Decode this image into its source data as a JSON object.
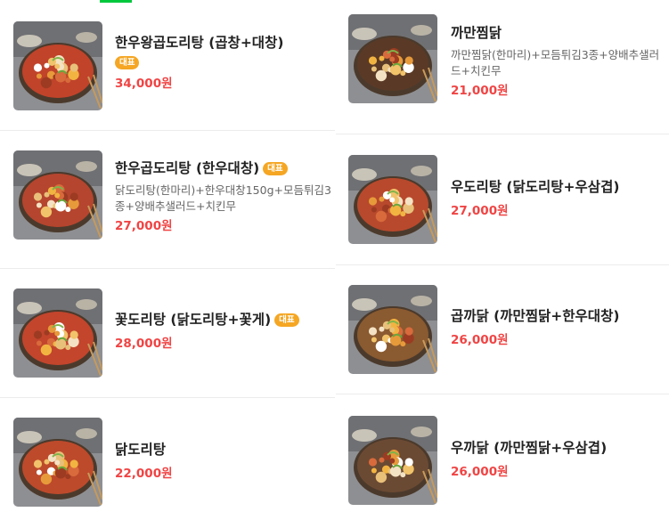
{
  "menu": {
    "left": [
      {
        "name": "한우왕곱도리탕 (곱창+대창)",
        "badge": "대표",
        "desc": "",
        "price": "34,000원"
      },
      {
        "name": "한우곱도리탕 (한우대창)",
        "badge": "대표",
        "desc": "닭도리탕(한마리)+한우대창150g+모듬튀김3종+양배추샐러드+치킨무",
        "price": "27,000원"
      },
      {
        "name": "꽃도리탕 (닭도리탕+꽃게)",
        "badge": "대표",
        "desc": "",
        "price": "28,000원"
      },
      {
        "name": "닭도리탕",
        "badge": "",
        "desc": "",
        "price": "22,000원"
      }
    ],
    "right": [
      {
        "name": "까만찜닭",
        "badge": "",
        "desc": "까만찜닭(한마리)+모듬튀김3종+양배추샐러드+치킨무",
        "price": "21,000원"
      },
      {
        "name": "우도리탕 (닭도리탕+우삼겹)",
        "badge": "",
        "desc": "",
        "price": "27,000원"
      },
      {
        "name": "곱까닭 (까만찜닭+한우대창)",
        "badge": "",
        "desc": "",
        "price": "26,000원"
      },
      {
        "name": "우까닭 (까만찜닭+우삼겹)",
        "badge": "",
        "desc": "",
        "price": "26,000원"
      }
    ]
  },
  "colors": {
    "accent_green": "#00c73c",
    "price_red": "#f04444",
    "badge_orange": "#f5a623"
  },
  "icons": {
    "thumbnail": "food-photo"
  }
}
